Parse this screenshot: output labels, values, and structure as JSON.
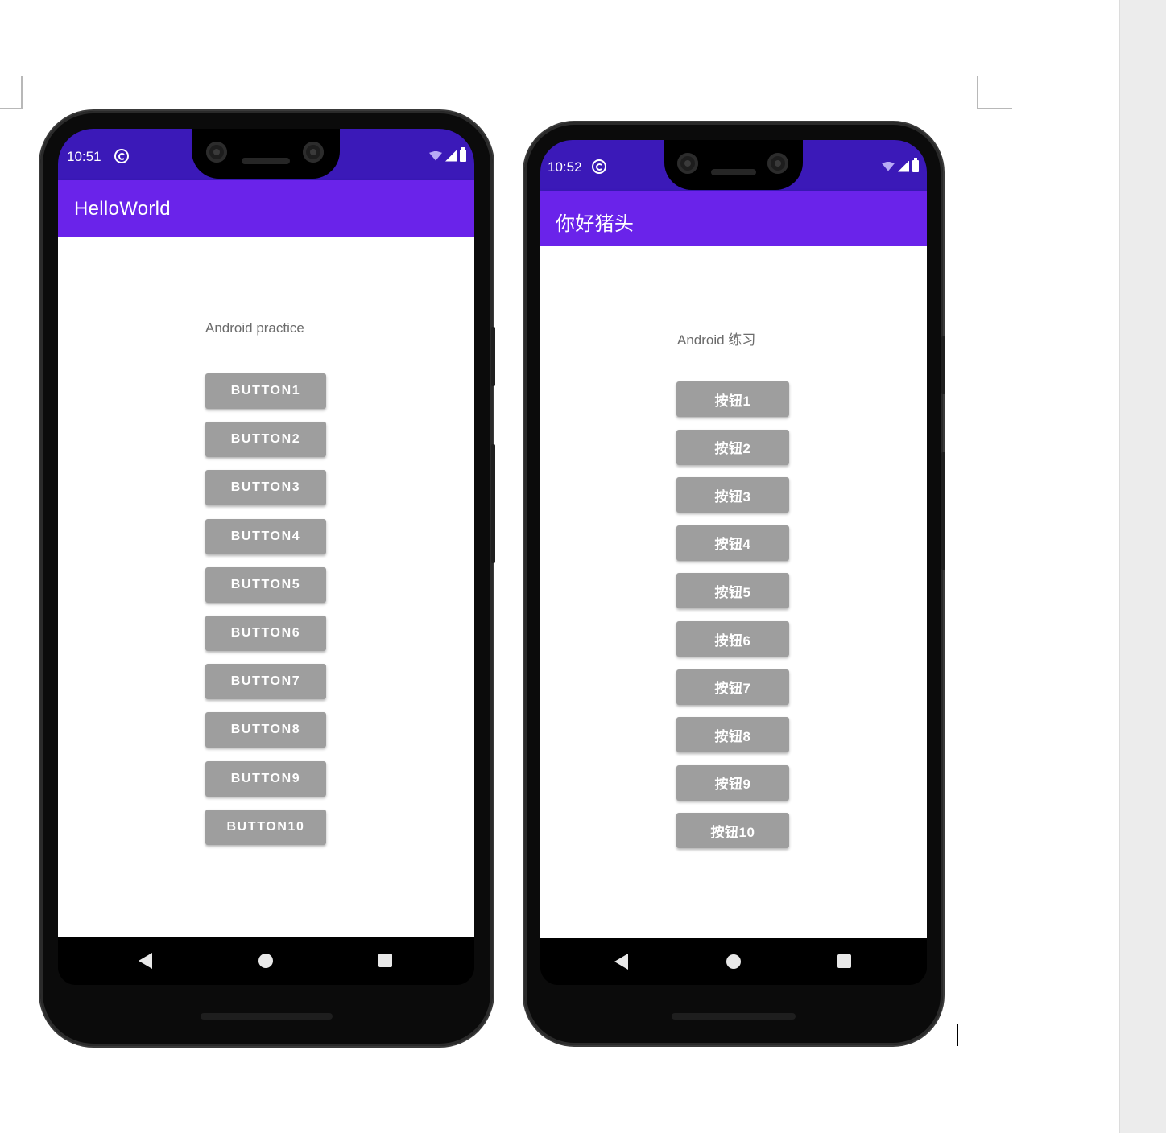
{
  "phone_left": {
    "status": {
      "time": "10:51"
    },
    "app_title": "HelloWorld",
    "label": "Android practice",
    "buttons": [
      "BUTTON1",
      "BUTTON2",
      "BUTTON3",
      "BUTTON4",
      "BUTTON5",
      "BUTTON6",
      "BUTTON7",
      "BUTTON8",
      "BUTTON9",
      "BUTTON10"
    ]
  },
  "phone_right": {
    "status": {
      "time": "10:52"
    },
    "app_title": "你好猪头",
    "label": "Android 练习",
    "buttons": [
      "按钮1",
      "按钮2",
      "按钮3",
      "按钮4",
      "按钮5",
      "按钮6",
      "按钮7",
      "按钮8",
      "按钮9",
      "按钮10"
    ]
  },
  "colors": {
    "status_bar": "#3b19b8",
    "app_bar": "#6a23ea",
    "button_bg": "#9e9e9e",
    "label_text": "#6b6b6b"
  },
  "icons": {
    "status": [
      "sync-icon",
      "wifi-icon",
      "signal-icon",
      "battery-icon"
    ],
    "nav": [
      "back-icon",
      "home-icon",
      "recents-icon"
    ]
  }
}
